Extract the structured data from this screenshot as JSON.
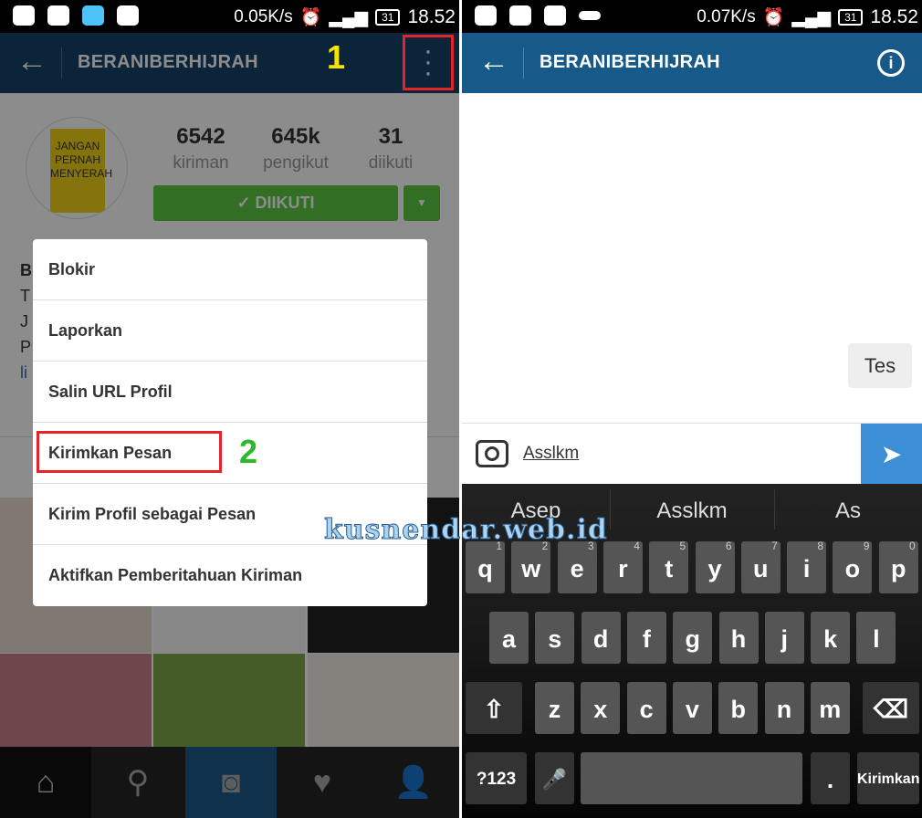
{
  "left": {
    "status": {
      "speed": "0.05K/s",
      "battery": "31",
      "time": "18.52"
    },
    "header": {
      "title": "BERANIBERHIJRAH",
      "annotation": "1"
    },
    "profile": {
      "stats": [
        {
          "value": "6542",
          "label": "kiriman"
        },
        {
          "value": "645k",
          "label": "pengikut"
        },
        {
          "value": "31",
          "label": "diikuti"
        }
      ],
      "follow_label": "✓ DIIKUTI",
      "avatar_text": "JANGAN PERNAH MENYERAH",
      "bio_fragments": [
        "B",
        "T",
        "J",
        "P",
        "li"
      ]
    },
    "menu": {
      "items": [
        "Blokir",
        "Laporkan",
        "Salin URL Profil",
        "Kirimkan Pesan",
        "Kirim Profil sebagai Pesan",
        "Aktifkan Pemberitahuan Kiriman"
      ],
      "annotation": "2"
    },
    "nav": [
      "home-icon",
      "search-icon",
      "camera-icon",
      "activity-heart-icon",
      "profile-icon"
    ],
    "colors": {
      "header": "#0b2437",
      "follow": "#3f9a2b",
      "highlight": "#e5232b",
      "annot1": "#f4e400",
      "annot2": "#2eb82e"
    }
  },
  "watermark": "kusnendar.web.id",
  "right": {
    "status": {
      "speed": "0.07K/s",
      "battery": "31",
      "time": "18.52"
    },
    "header": {
      "title": "BERANIBERHIJRAH"
    },
    "messages": [
      {
        "text": "Tes",
        "from": "me"
      }
    ],
    "composer": {
      "value": "Asslkm"
    },
    "keyboard": {
      "suggestions": [
        "Asep",
        "Asslkm",
        "As"
      ],
      "row1": [
        "q",
        "w",
        "e",
        "r",
        "t",
        "y",
        "u",
        "i",
        "o",
        "p"
      ],
      "row1_nums": [
        "1",
        "2",
        "3",
        "4",
        "5",
        "6",
        "7",
        "8",
        "9",
        "0"
      ],
      "row2": [
        "a",
        "s",
        "d",
        "f",
        "g",
        "h",
        "j",
        "k",
        "l"
      ],
      "row3": [
        "z",
        "x",
        "c",
        "v",
        "b",
        "n",
        "m"
      ],
      "symbols_label": "?123",
      "period": ".",
      "action_label": "Kirimkan"
    },
    "colors": {
      "header": "#175a8a",
      "send": "#3d8fd6",
      "bubble": "#eeeeee"
    }
  }
}
